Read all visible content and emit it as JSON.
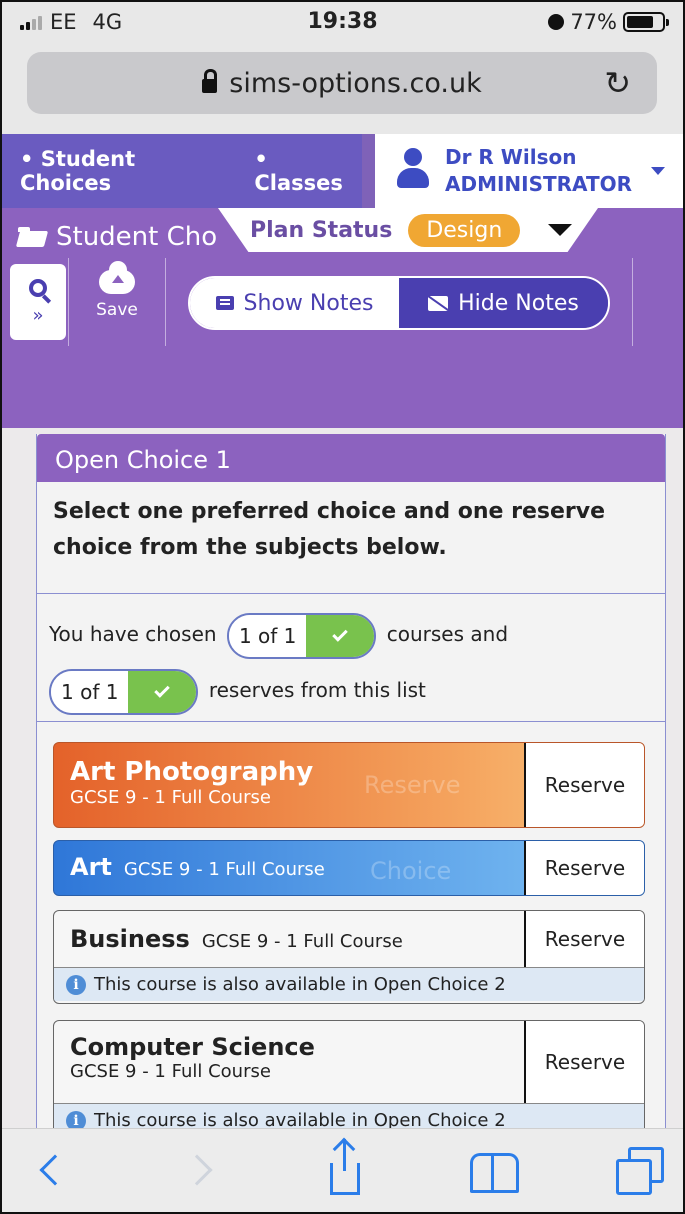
{
  "status_bar": {
    "carrier": "EE",
    "network": "4G",
    "time": "19:38",
    "battery": "77%",
    "battery_level": 0.77
  },
  "browser": {
    "url": "sims-options.co.uk"
  },
  "app_nav": {
    "links": [
      "Student Choices",
      "Classes"
    ],
    "user_name": "Dr R Wilson",
    "user_role": "ADMINISTRATOR"
  },
  "toolbar": {
    "breadcrumb": "Student Cho",
    "plan_status_label": "Plan Status",
    "plan_status_value": "Design",
    "save_label": "Save",
    "show_notes": "Show Notes",
    "hide_notes": "Hide Notes"
  },
  "choice_panel": {
    "title": "Open Choice 1",
    "instruction": "Select one preferred choice and one reserve choice from the subjects below.",
    "chosen_prefix": "You have chosen",
    "courses_count": "1 of 1",
    "courses_suffix": "courses and",
    "reserves_count": "1 of 1",
    "reserves_suffix": "reserves from this list"
  },
  "courses": [
    {
      "name": "Art Photography",
      "level": "GCSE 9 - 1 Full Course",
      "ghost": "Reserve",
      "button": "Reserve",
      "note": ""
    },
    {
      "name": "Art",
      "level": "GCSE 9 - 1 Full Course",
      "ghost": "Choice",
      "button": "Reserve",
      "note": ""
    },
    {
      "name": "Business",
      "level": "GCSE 9 - 1 Full Course",
      "ghost": "",
      "button": "Reserve",
      "note": "This course is also available in Open Choice 2"
    },
    {
      "name": "Computer Science",
      "level": "GCSE 9 - 1 Full Course",
      "ghost": "",
      "button": "Reserve",
      "note": "This course is also available in Open Choice 2"
    }
  ],
  "colors": {
    "purple": "#8c62bf",
    "blue_accent": "#3d4cc2",
    "design_badge": "#f0a733",
    "check_green": "#79c24d"
  },
  "icons": [
    "signal-icon",
    "alarm-icon",
    "battery-icon",
    "lock-icon",
    "reload-icon",
    "user-icon",
    "folder-icon",
    "search-icon",
    "cloud-upload-icon",
    "notes-icon",
    "info-icon",
    "back-icon",
    "forward-icon",
    "share-icon",
    "bookmarks-icon",
    "tabs-icon"
  ]
}
